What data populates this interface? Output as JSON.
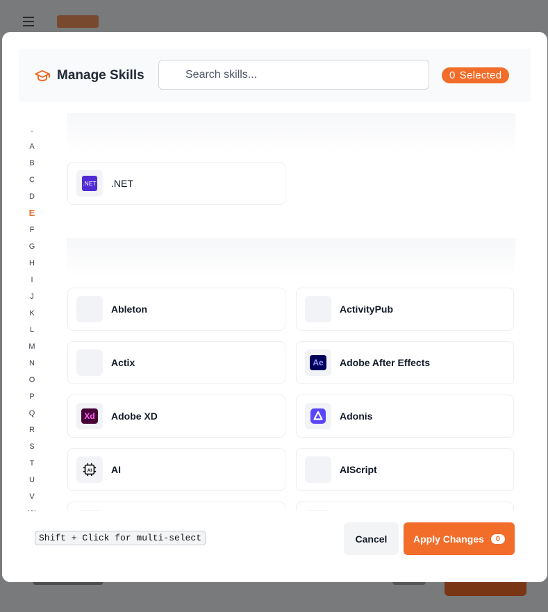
{
  "modal": {
    "title": "Manage Skills",
    "search_placeholder": "Search skills...",
    "selected_count": "0",
    "selected_label": "Selected"
  },
  "alphabet": [
    ".",
    "A",
    "B",
    "C",
    "D",
    "E",
    "F",
    "G",
    "H",
    "I",
    "J",
    "K",
    "L",
    "M",
    "N",
    "O",
    "P",
    "Q",
    "R",
    "S",
    "T",
    "U",
    "V",
    "W"
  ],
  "active_letter": "E",
  "skills": {
    "dotnet": ".NET",
    "ableton": "Ableton",
    "activitypub": "ActivityPub",
    "actix": "Actix",
    "after_effects": "Adobe After Effects",
    "adobe_xd": "Adobe XD",
    "adonis": "Adonis",
    "ai": "AI",
    "aiscript": "AIScript"
  },
  "icons": {
    "dotnet": ".NET",
    "after_effects": "Ae",
    "adobe_xd": "Xd",
    "ai": "AI"
  },
  "footer": {
    "hint": "Shift + Click for multi-select",
    "cancel": "Cancel",
    "apply": "Apply Changes",
    "apply_count": "0"
  },
  "colors": {
    "accent": "#f26c2a",
    "dotnet": "#512bd4",
    "after_effects": "#00005b",
    "adobe_xd": "#470137",
    "adonis": "#5a45ff"
  }
}
